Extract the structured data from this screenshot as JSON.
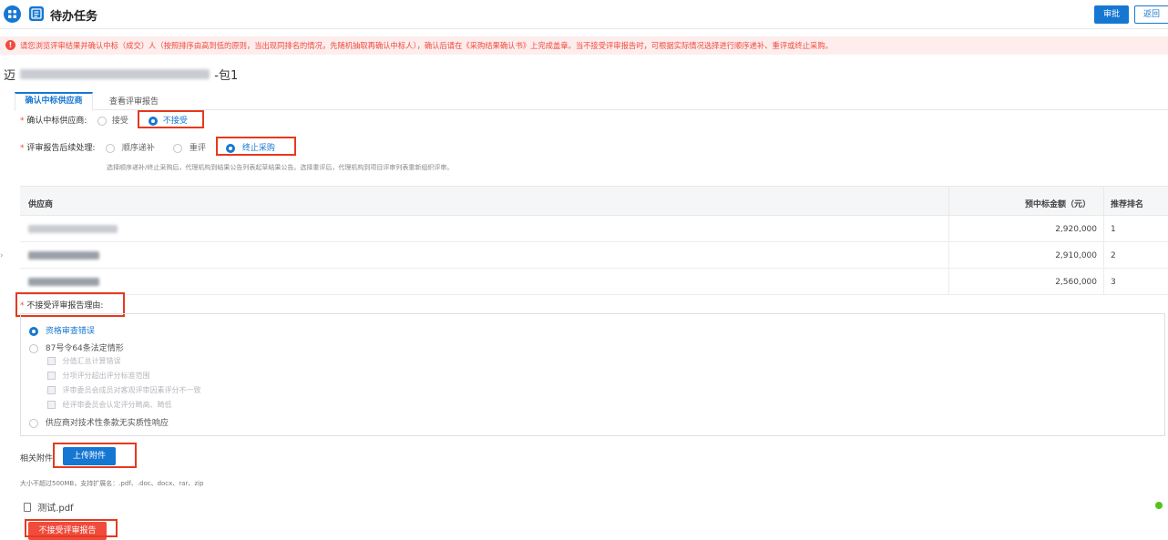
{
  "header": {
    "title": "待办任务",
    "approve_button": "审批",
    "back_button": "返回"
  },
  "notice": "请您浏览评审结果并确认中标（成交）人（按照排序由高到低的原则，当出现同排名的情况，先随机抽取再确认中标人），确认后请在《采购结果确认书》上完成盖章。当不接受评审报告时，可根据实际情况选择进行顺序递补、重评或终止采购。",
  "project_title": {
    "prefix": "迈",
    "suffix": "-包1"
  },
  "tabs": [
    "确认中标供应商",
    "查看评审报告"
  ],
  "confirm": {
    "label": "确认中标供应商:",
    "options": [
      "接受",
      "不接受"
    ],
    "selected": "不接受"
  },
  "followup": {
    "label": "评审报告后续处理:",
    "options": [
      "顺序递补",
      "重评",
      "终止采购"
    ],
    "selected": "终止采购",
    "hint": "选择顺序递补/终止采购后，代理机构到结果公告列表起草结果公告。选择重评后，代理机构到项目评审列表重新组织评审。"
  },
  "table": {
    "headers": [
      "供应商",
      "预中标金额（元）",
      "推荐排名"
    ],
    "rows": [
      {
        "amount": "2,920,000",
        "rank": "1"
      },
      {
        "amount": "2,910,000",
        "rank": "2"
      },
      {
        "amount": "2,560,000",
        "rank": "3"
      }
    ]
  },
  "reason": {
    "label": "不接受评审报告理由:",
    "options": [
      "资格审查错误",
      "87号令64条法定情形",
      "供应商对技术性条款无实质性响应"
    ],
    "selected": "资格审查错误",
    "sub_options": [
      "分值汇总计算错误",
      "分项评分超出评分标准范围",
      "评审委员会成员对客观评审因素评分不一致",
      "经评审委员会认定评分畸高、畸低"
    ]
  },
  "attachment": {
    "label": "相关附件:",
    "upload_button": "上传附件",
    "hint": "大小不超过500MB，支持扩展名：.pdf、.doc、docx、rar、zip",
    "file_name": "测试.pdf"
  },
  "submit_button": "不接受评审报告",
  "colors": {
    "primary": "#1677d2",
    "danger": "#f04b3c",
    "notice_bg": "#fdeded",
    "highlight": "#e53a1e",
    "success": "#52c41a"
  }
}
